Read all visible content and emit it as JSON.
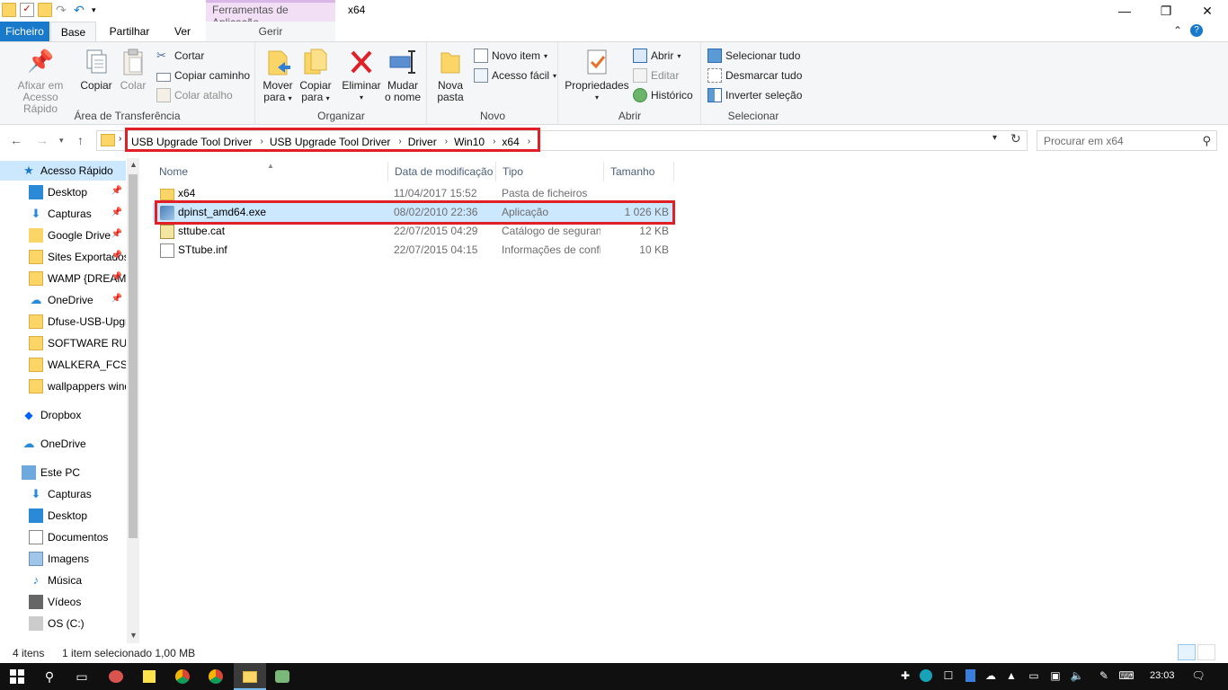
{
  "window": {
    "title": "x64",
    "context_tab": "Ferramentas de Aplicação",
    "controls": {
      "minimize": "—",
      "maximize": "❐",
      "close": "✕"
    }
  },
  "tabs": {
    "file": "Ficheiro",
    "home": "Base",
    "share": "Partilhar",
    "view": "Ver",
    "manage": "Gerir"
  },
  "ribbon": {
    "clipboard": {
      "label": "Área de Transferência",
      "pin": "Afixar em\nAcesso Rápido",
      "pin_l1": "Afixar em",
      "pin_l2": "Acesso Rápido",
      "copy": "Copiar",
      "paste": "Colar",
      "cut": "Cortar",
      "copy_path": "Copiar caminho",
      "paste_shortcut": "Colar atalho"
    },
    "organize": {
      "label": "Organizar",
      "move_l1": "Mover",
      "move_l2": "para",
      "copy_l1": "Copiar",
      "copy_l2": "para",
      "delete": "Eliminar",
      "rename_l1": "Mudar",
      "rename_l2": "o nome"
    },
    "new": {
      "label": "Novo",
      "folder_l1": "Nova",
      "folder_l2": "pasta",
      "new_item": "Novo item",
      "easy_access": "Acesso fácil"
    },
    "open": {
      "label": "Abrir",
      "properties": "Propriedades",
      "open": "Abrir",
      "edit": "Editar",
      "history": "Histórico"
    },
    "select": {
      "label": "Selecionar",
      "select_all": "Selecionar tudo",
      "select_none": "Desmarcar tudo",
      "invert": "Inverter seleção"
    }
  },
  "address": {
    "crumbs": [
      "USB Upgrade Tool Driver",
      "USB Upgrade Tool Driver",
      "Driver",
      "Win10",
      "x64"
    ],
    "search_placeholder": "Procurar em x64"
  },
  "nav": {
    "items": [
      {
        "label": "Acesso Rápido",
        "icon": "star-icon",
        "pinned": false,
        "level": 0
      },
      {
        "label": "Desktop",
        "icon": "desktop-icon",
        "pinned": true,
        "level": 1
      },
      {
        "label": "Capturas",
        "icon": "download-icon",
        "pinned": true,
        "level": 1
      },
      {
        "label": "Google Drive",
        "icon": "google-drive-icon",
        "pinned": true,
        "level": 1
      },
      {
        "label": "Sites Exportados",
        "icon": "folder-icon",
        "pinned": true,
        "level": 1
      },
      {
        "label": "WAMP {DREAMWEAVER}",
        "icon": "folder-icon",
        "pinned": true,
        "level": 1
      },
      {
        "label": "OneDrive",
        "icon": "onedrive-icon",
        "pinned": true,
        "level": 1
      },
      {
        "label": "Dfuse-USB-Upgrade",
        "icon": "folder-icon",
        "pinned": false,
        "level": 1
      },
      {
        "label": "SOFTWARE RUNNER",
        "icon": "folder-icon",
        "pinned": false,
        "level": 1
      },
      {
        "label": "WALKERA_FCS_F",
        "icon": "folder-icon",
        "pinned": false,
        "level": 1
      },
      {
        "label": "wallpappers windows",
        "icon": "folder-icon",
        "pinned": false,
        "level": 1
      },
      {
        "label": "Dropbox",
        "icon": "dropbox-icon",
        "pinned": false,
        "level": 0
      },
      {
        "label": "OneDrive",
        "icon": "onedrive-icon",
        "pinned": false,
        "level": 0
      },
      {
        "label": "Este PC",
        "icon": "computer-icon",
        "pinned": false,
        "level": 0
      },
      {
        "label": "Capturas",
        "icon": "download-icon",
        "pinned": false,
        "level": 1
      },
      {
        "label": "Desktop",
        "icon": "desktop-icon",
        "pinned": false,
        "level": 1
      },
      {
        "label": "Documentos",
        "icon": "document-icon",
        "pinned": false,
        "level": 1
      },
      {
        "label": "Imagens",
        "icon": "image-icon",
        "pinned": false,
        "level": 1
      },
      {
        "label": "Música",
        "icon": "music-icon",
        "pinned": false,
        "level": 1
      },
      {
        "label": "Vídeos",
        "icon": "video-icon",
        "pinned": false,
        "level": 1
      },
      {
        "label": "OS (C:)",
        "icon": "drive-icon",
        "pinned": false,
        "level": 1
      }
    ]
  },
  "columns": {
    "name": "Nome",
    "date": "Data de modificação",
    "type": "Tipo",
    "size": "Tamanho"
  },
  "files": [
    {
      "name": "x64",
      "date": "11/04/2017 15:52",
      "type": "Pasta de ficheiros",
      "size": "",
      "icon": "folder-icon"
    },
    {
      "name": "dpinst_amd64.exe",
      "date": "08/02/2010 22:36",
      "type": "Aplicação",
      "size": "1 026 KB",
      "icon": "installer-icon"
    },
    {
      "name": "sttube.cat",
      "date": "22/07/2015 04:29",
      "type": "Catálogo de segurança",
      "size": "12 KB",
      "icon": "catalog-icon"
    },
    {
      "name": "STtube.inf",
      "date": "22/07/2015 04:15",
      "type": "Informações de configuração",
      "size": "10 KB",
      "icon": "inf-file-icon"
    }
  ],
  "status": {
    "count": "4 itens",
    "selection": "1 item selecionado 1,00 MB"
  },
  "taskbar": {
    "time": "23:03"
  },
  "colors": {
    "accent": "#1979ca",
    "selection": "#cce8ff",
    "highlight_box": "#e01f26",
    "folder": "#fbd666"
  }
}
